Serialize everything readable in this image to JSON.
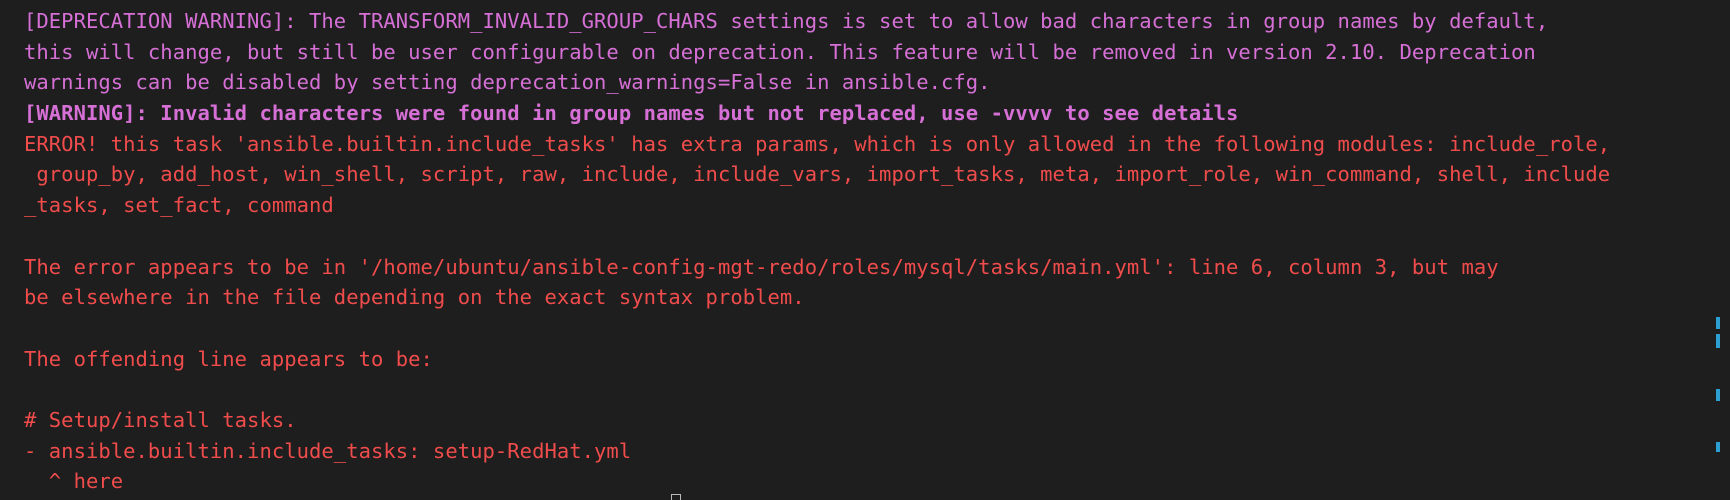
{
  "terminal": {
    "lines": [
      "[DEPRECATION WARNING]: The TRANSFORM_INVALID_GROUP_CHARS settings is set to allow bad characters in group names by default,",
      "this will change, but still be user configurable on deprecation. This feature will be removed in version 2.10. Deprecation",
      "warnings can be disabled by setting deprecation_warnings=False in ansible.cfg.",
      "[WARNING]: Invalid characters were found in group names but not replaced, use -vvvv to see details",
      "ERROR! this task 'ansible.builtin.include_tasks' has extra params, which is only allowed in the following modules: include_role,",
      " group_by, add_host, win_shell, script, raw, include, include_vars, import_tasks, meta, import_role, win_command, shell, include",
      "_tasks, set_fact, command",
      "",
      "The error appears to be in '/home/ubuntu/ansible-config-mgt-redo/roles/mysql/tasks/main.yml': line 6, column 3, but may",
      "be elsewhere in the file depending on the exact syntax problem.",
      "",
      "The offending line appears to be:",
      "",
      "# Setup/install tasks.",
      "- ansible.builtin.include_tasks: setup-RedHat.yml",
      "  ^ here"
    ],
    "colors": {
      "background": "#1e1e1e",
      "deprecation": "#d670d6",
      "warning": "#d670d6",
      "error": "#f14c4c",
      "scroll_marker": "#2b9fd1"
    }
  }
}
